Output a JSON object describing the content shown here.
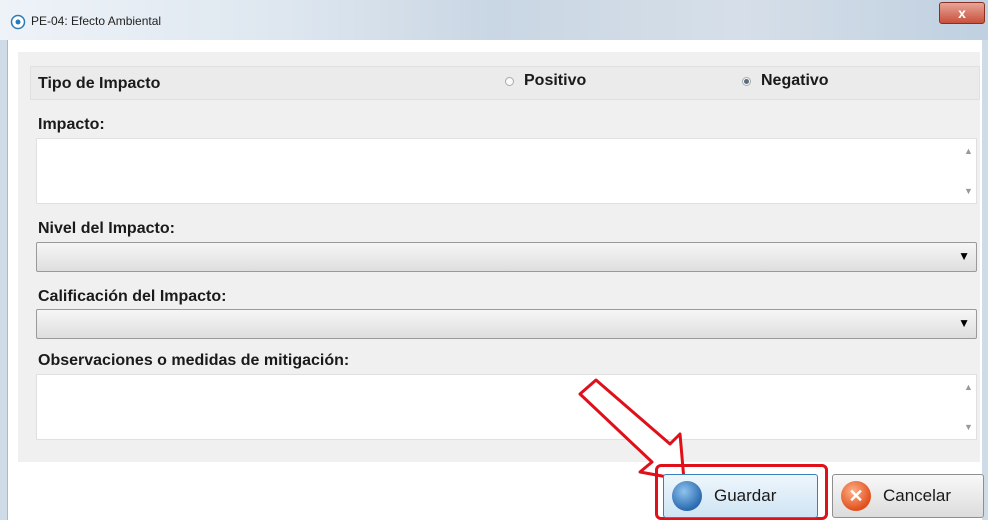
{
  "window": {
    "title": "PE-04: Efecto Ambiental",
    "close_label": "x"
  },
  "form": {
    "tipo_label": "Tipo de Impacto",
    "options": [
      {
        "label": "Positivo",
        "selected": false
      },
      {
        "label": "Negativo",
        "selected": true
      }
    ],
    "impacto_label": "Impacto:",
    "impacto_value": "",
    "nivel_label": "Nivel del Impacto:",
    "nivel_value": "",
    "calificacion_label": "Calificación del Impacto:",
    "calificacion_value": "",
    "observaciones_label": "Observaciones o medidas de mitigación:",
    "observaciones_value": ""
  },
  "buttons": {
    "save_label": "Guardar",
    "cancel_label": "Cancelar"
  },
  "icons": {
    "window": "window-icon",
    "save": "save-icon",
    "cancel": "cancel-icon",
    "dropdown": "chevron-down-icon"
  },
  "colors": {
    "highlight": "#e0101a",
    "save_border": "#3a7fb8",
    "close_button": "#c8503c"
  }
}
